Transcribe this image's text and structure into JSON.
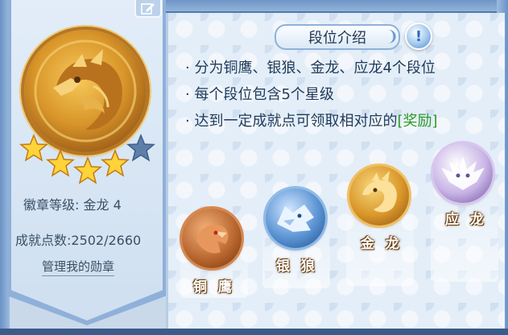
{
  "badge_panel": {
    "level_label": "徽章等级: 金龙 4",
    "points_label": "成就点数:2502/2660",
    "manage_link": "管理我的勋章",
    "filled_stars": 4,
    "total_stars": 5
  },
  "intro": {
    "title": "段位介绍",
    "info_symbol": "!",
    "bullets": [
      "· 分为铜鹰、银狼、金龙、应龙4个段位",
      "· 每个段位包含5个星级"
    ],
    "bullet3_prefix": "· 达到一定成就点可领取相对应的",
    "bullet3_reward": "[奖励]"
  },
  "tiers": [
    {
      "name": "铜 鹰",
      "icon": "eagle-icon",
      "color": "#b4622a"
    },
    {
      "name": "银 狼",
      "icon": "wolf-icon",
      "color": "#3c74b8"
    },
    {
      "name": "金 龙",
      "icon": "dragon-icon",
      "color": "#d79a2a"
    },
    {
      "name": "应 龙",
      "icon": "winged-dragon-icon",
      "color": "#8b6ab0"
    }
  ],
  "colors": {
    "reward_text": "#2a9a2a",
    "gold": "#d9962a"
  }
}
